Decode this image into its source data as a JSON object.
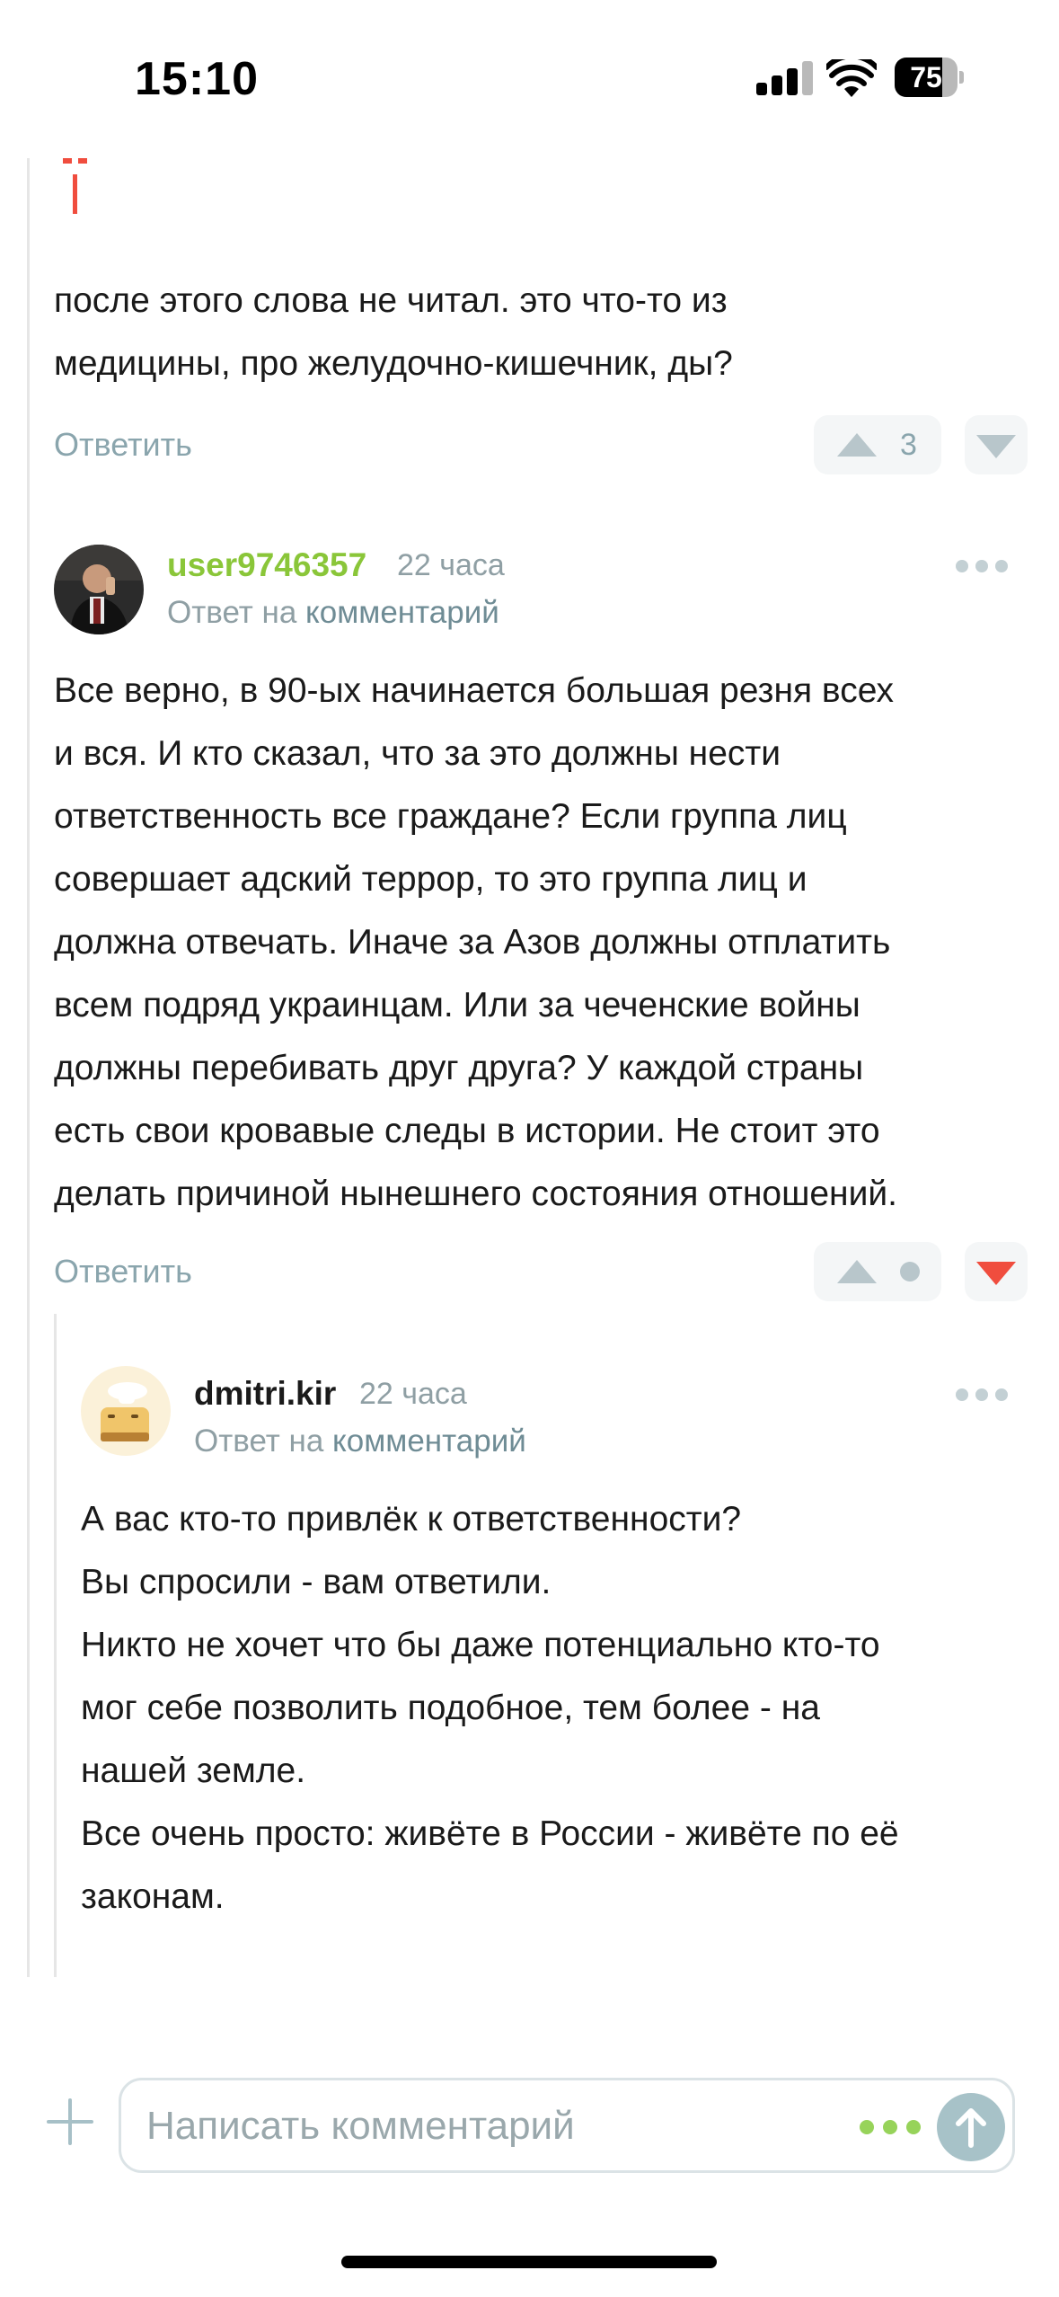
{
  "status_bar": {
    "time": "15:10",
    "battery": "75",
    "battery_level": 0.75
  },
  "comments": [
    {
      "text_lines": [
        "после этого слова не читал. это что-то из",
        "медицины, про желудочно-кишечник, ды?"
      ],
      "reply_label": "Ответить",
      "score": "3"
    },
    {
      "author": "user9746357",
      "time": "22 часа",
      "reply_to_prefix": "Ответ на",
      "reply_to_link": "комментарий",
      "text_lines": [
        "Все верно, в 90-ых начинается большая резня всех",
        "и вся. И кто сказал, что за это должны нести",
        "ответственность все граждане? Если группа лиц",
        "совершает адский террор, то это группа лиц и",
        "должна отвечать. Иначе за Азов должны отплатить",
        "всем подряд украинцам. Или за чеченские войны",
        "должны перебивать друг друга? У каждой страны",
        "есть свои кровавые следы в истории. Не стоит это",
        "делать причиной нынешнего состояния отношений."
      ],
      "reply_label": "Ответить",
      "author_color": "#8ac639"
    },
    {
      "author": "dmitri.kir",
      "time": "22 часа",
      "reply_to_prefix": "Ответ на",
      "reply_to_link": "комментарий",
      "text_lines": [
        "А вас кто-то привлёк к ответственности?",
        "Вы спросили - вам ответили.",
        "Никто не хочет что бы даже потенциально кто-то",
        "мог себе позволить подобное, тем более - на",
        "нашей земле.",
        "Все очень просто: живёте в России - живёте по её",
        "законам."
      ]
    }
  ],
  "composer": {
    "placeholder": "Написать комментарий"
  },
  "colors": {
    "accent_red": "#f04d3e",
    "accent_green": "#8ac639",
    "muted": "#8aa5ad"
  }
}
